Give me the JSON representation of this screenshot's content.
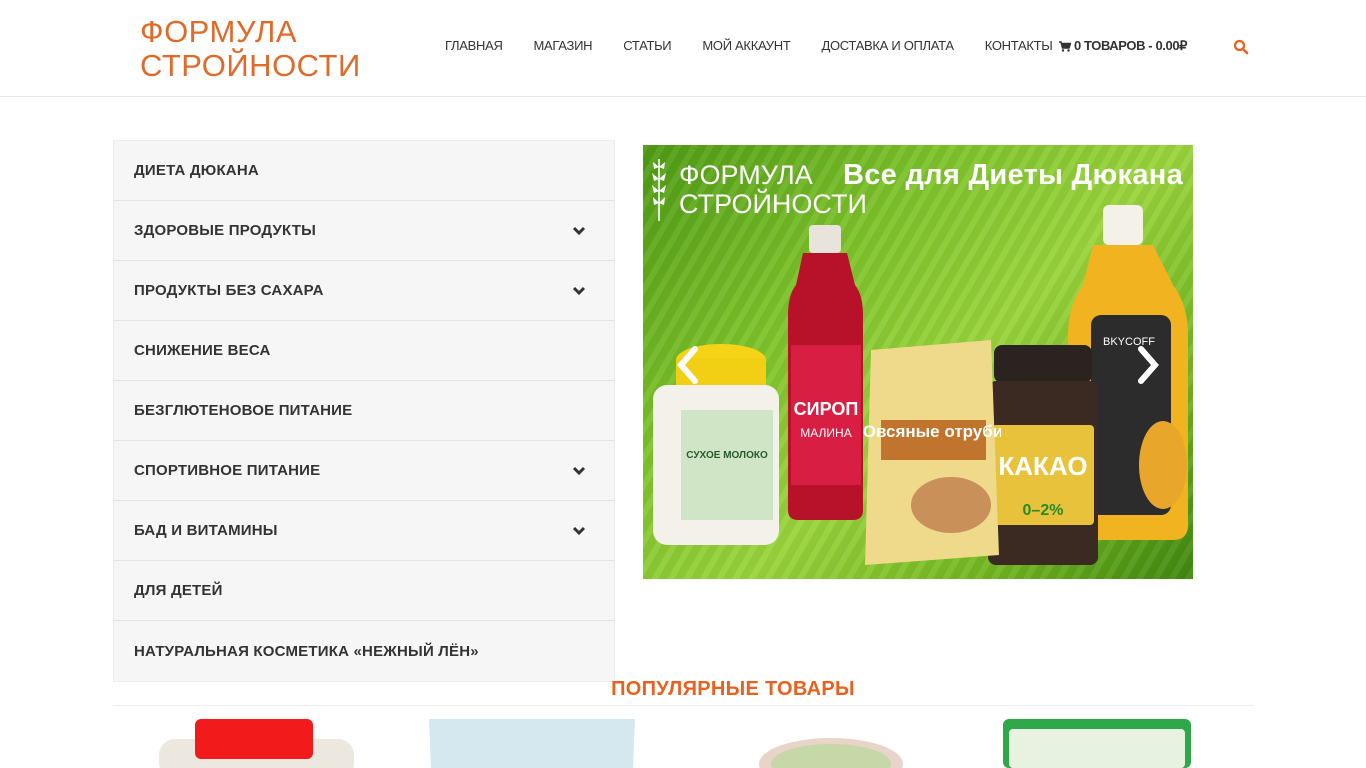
{
  "brand": {
    "name_line1": "ФОРМУЛА",
    "name_line2": "СТРОЙНОСТИ",
    "color": "#e06a2a"
  },
  "nav": {
    "items": [
      {
        "label": "ГЛАВНАЯ"
      },
      {
        "label": "МАГАЗИН"
      },
      {
        "label": "СТАТЬИ"
      },
      {
        "label": "МОЙ АККАУНТ"
      },
      {
        "label": "ДОСТАВКА И ОПЛАТА"
      },
      {
        "label": "КОНТАКТЫ"
      }
    ],
    "cart_label": "0 ТОВАРОВ - 0.00₽",
    "cart_icon": "cart-icon",
    "search_icon": "search-icon"
  },
  "categories": [
    {
      "label": "ДИЕТА ДЮКАНА",
      "has_submenu": false
    },
    {
      "label": "ЗДОРОВЫЕ ПРОДУКТЫ",
      "has_submenu": true
    },
    {
      "label": "ПРОДУКТЫ БЕЗ САХАРА",
      "has_submenu": true
    },
    {
      "label": "СНИЖЕНИЕ ВЕСА",
      "has_submenu": false
    },
    {
      "label": "БЕЗГЛЮТЕНОВОЕ ПИТАНИЕ",
      "has_submenu": false
    },
    {
      "label": "СПОРТИВНОЕ ПИТАНИЕ",
      "has_submenu": true
    },
    {
      "label": "БАД И ВИТАМИНЫ",
      "has_submenu": true
    },
    {
      "label": "ДЛЯ ДЕТЕЙ",
      "has_submenu": false
    },
    {
      "label": "НАТУРАЛЬНАЯ КОСМЕТИКА «НЕЖНЫЙ ЛЁН»",
      "has_submenu": false
    }
  ],
  "slider": {
    "logo_line1": "ФОРМУЛА",
    "logo_line2": "СТРОЙНОСТИ",
    "title": "Все для Диеты Дюкана",
    "products": {
      "milk_title": "СУХОЕ МОЛОКО",
      "syrup_title": "СИРОП",
      "syrup_flavor": "МАЛИНА",
      "oat_title": "Овсяные отруби",
      "cocoa_title": "КАКАО",
      "cocoa_fat": "0–2%",
      "pineapple_brand": "BKYCOFF"
    }
  },
  "popular": {
    "title": "ПОПУЛЯРНЫЕ ТОВАРЫ"
  },
  "colors": {
    "accent": "#e8621f",
    "sidebar_bg": "#f6f6f6"
  }
}
